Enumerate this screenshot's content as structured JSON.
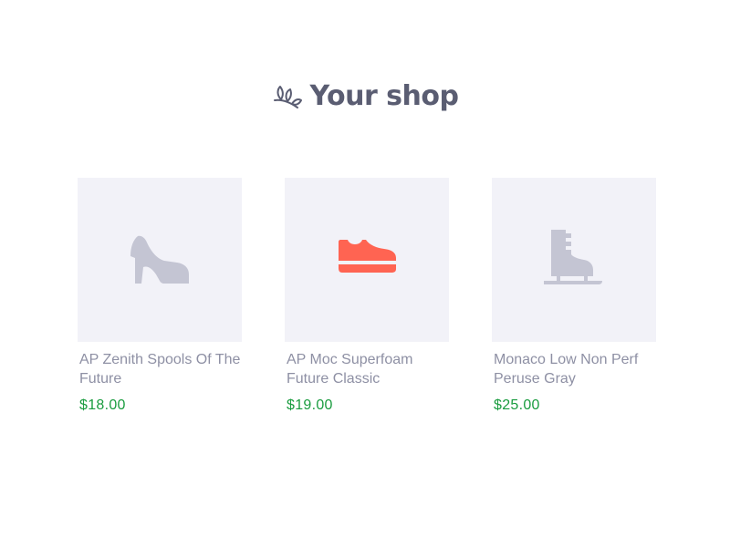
{
  "header": {
    "title": "Your shop",
    "logo_icon": "leaf-sprig-icon"
  },
  "colors": {
    "title": "#5a5d72",
    "thumb_bg": "#f2f2f8",
    "icon_muted": "#c4c5d3",
    "icon_accent": "#ff6452",
    "price": "#1a9c3f",
    "name": "#8e90a4"
  },
  "products": [
    {
      "name": "AP Zenith Spools Of The Future",
      "price": "$18.00",
      "icon": "high-heel-icon"
    },
    {
      "name": "AP Moc Superfoam Future Classic",
      "price": "$19.00",
      "icon": "sneaker-icon"
    },
    {
      "name": "Monaco Low Non Perf Peruse Gray",
      "price": "$25.00",
      "icon": "ice-skate-icon"
    }
  ]
}
